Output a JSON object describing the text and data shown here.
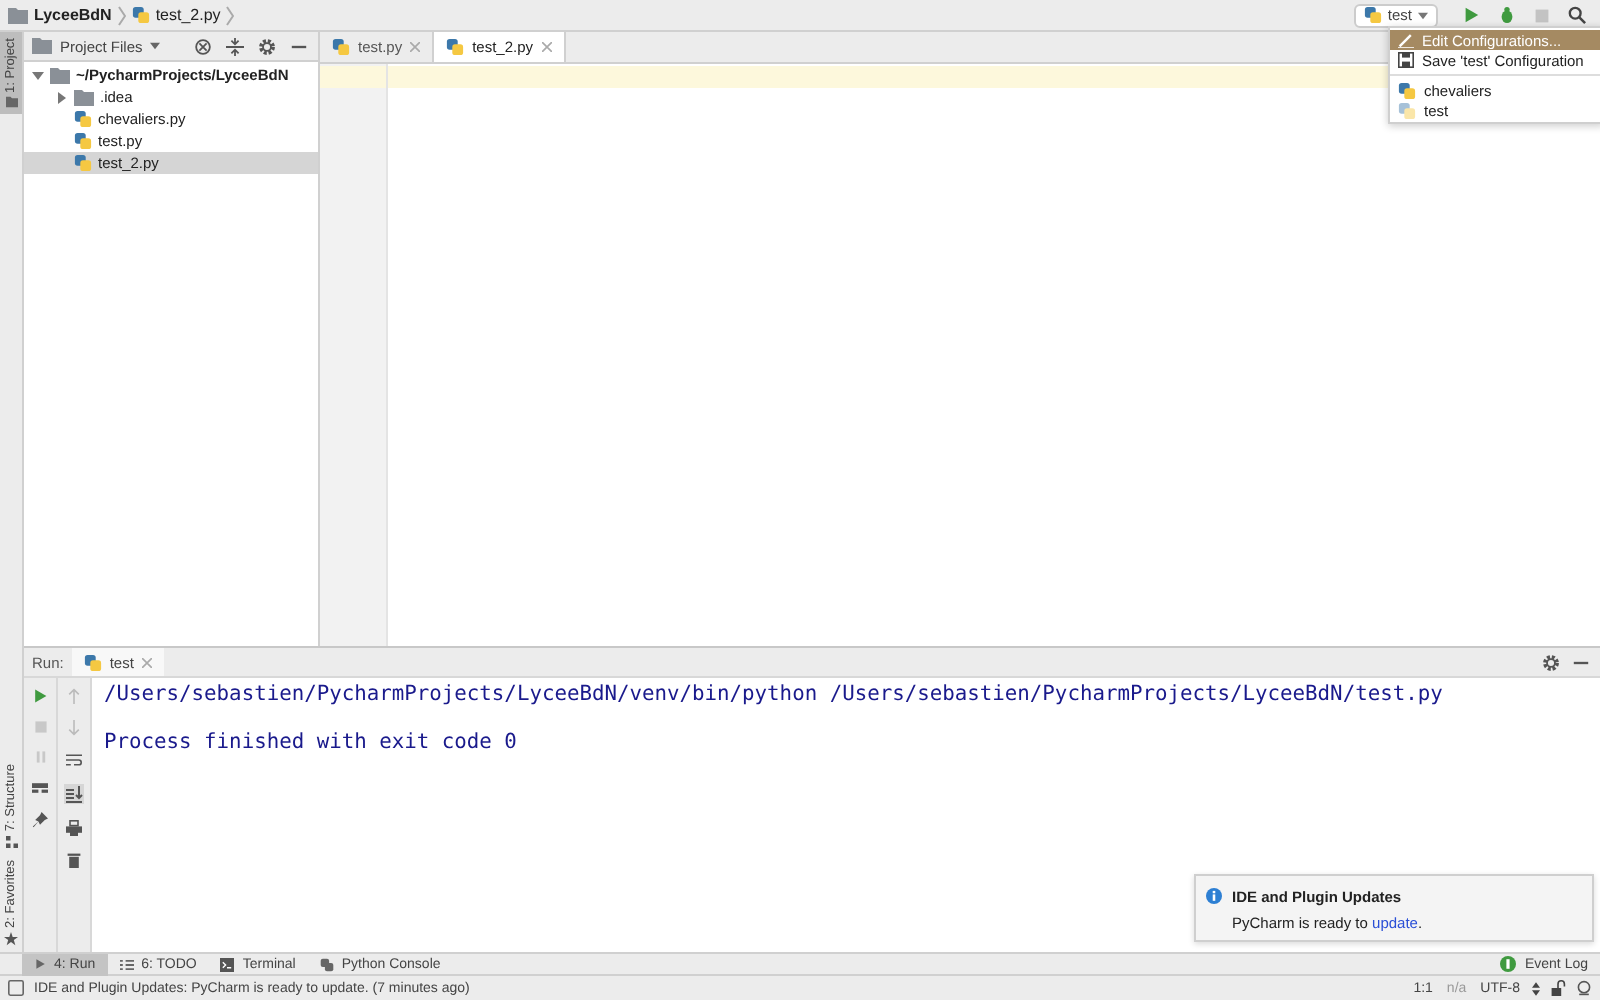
{
  "nav_bar": {
    "breadcrumbs": [
      {
        "label": "LyceeBdN",
        "kind": "folder"
      },
      {
        "label": "test_2.py",
        "kind": "python"
      }
    ],
    "run_config": "test"
  },
  "config_menu": {
    "actions": [
      {
        "label": "Edit Configurations...",
        "kind": "edit",
        "selected": true
      },
      {
        "label": "Save 'test' Configuration",
        "kind": "save",
        "selected": false
      }
    ],
    "configurations": [
      {
        "label": "chevaliers",
        "faded": false,
        "selected": false
      },
      {
        "label": "test",
        "faded": true,
        "selected": false
      }
    ]
  },
  "left_stripe": {
    "top": [
      {
        "label": "1: Project",
        "selected": true
      }
    ],
    "bottom": [
      {
        "label": "7: Structure",
        "selected": false,
        "kind": "structure"
      },
      {
        "label": "2: Favorites",
        "selected": false,
        "kind": "favorites"
      }
    ]
  },
  "project_panel": {
    "title": "Project Files",
    "tree": [
      {
        "label": "~/PycharmProjects/LyceeBdN",
        "kind": "folder",
        "expanded": true,
        "selected": false,
        "children": [
          {
            "label": ".idea",
            "kind": "folder",
            "expanded": false,
            "selected": false
          },
          {
            "label": "chevaliers.py",
            "kind": "python",
            "selected": false
          },
          {
            "label": "test.py",
            "kind": "python",
            "selected": false
          },
          {
            "label": "test_2.py",
            "kind": "python",
            "selected": true
          }
        ]
      }
    ]
  },
  "editor": {
    "tabs": [
      {
        "label": "test.py",
        "selected": false
      },
      {
        "label": "test_2.py",
        "selected": true
      }
    ]
  },
  "run_panel": {
    "label": "Run:",
    "tab": "test",
    "command": "/Users/sebastien/PycharmProjects/LyceeBdN/venv/bin/python /Users/sebastien/PycharmProjects/LyceeBdN/test.py",
    "exit_message": "Process finished with exit code 0"
  },
  "bottom_tools": [
    {
      "label": "4: Run",
      "kind": "run",
      "selected": true
    },
    {
      "label": "6: TODO",
      "kind": "todo",
      "selected": false
    },
    {
      "label": "Terminal",
      "kind": "terminal",
      "selected": false
    },
    {
      "label": "Python Console",
      "kind": "console",
      "selected": false
    }
  ],
  "event_log": "Event Log",
  "notification": {
    "title": "IDE and Plugin Updates",
    "text": "PyCharm is ready to",
    "link": "update",
    "end": "."
  },
  "status_bar": {
    "message": "IDE and Plugin Updates: PyCharm is ready to update. (7 minutes ago)",
    "position": "1:1",
    "vcs": "n/a",
    "encoding": "UTF-8"
  }
}
